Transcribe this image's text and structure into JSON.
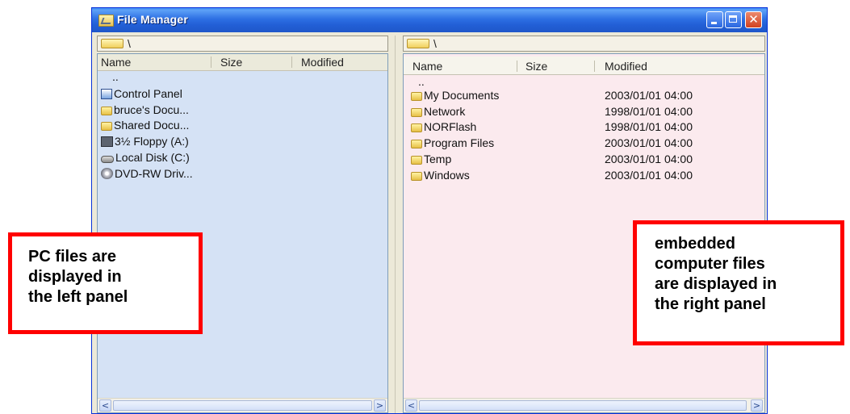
{
  "window": {
    "title": "File Manager",
    "controls": [
      "minimize-icon",
      "maximize-icon",
      "close-icon"
    ]
  },
  "left_pane": {
    "path": "\\",
    "columns": [
      "Name",
      "Size",
      "Modified"
    ],
    "items": [
      {
        "name": "..",
        "icon": "parent-dir",
        "size": "",
        "modified": ""
      },
      {
        "name": "Control Panel",
        "icon": "control-panel-icon",
        "size": "",
        "modified": ""
      },
      {
        "name": "bruce's Docu...",
        "icon": "folder-icon",
        "size": "",
        "modified": ""
      },
      {
        "name": "Shared Docu...",
        "icon": "folder-icon",
        "size": "",
        "modified": ""
      },
      {
        "name": "3½ Floppy (A:)",
        "icon": "floppy-drive-icon",
        "size": "",
        "modified": ""
      },
      {
        "name": "Local Disk (C:)",
        "icon": "hard-disk-icon",
        "size": "",
        "modified": ""
      },
      {
        "name": "DVD-RW Driv...",
        "icon": "dvd-drive-icon",
        "size": "",
        "modified": ""
      }
    ],
    "scrollbar": {
      "left_arrow": "<",
      "right_arrow": ">"
    }
  },
  "right_pane": {
    "path": "\\",
    "columns": [
      "Name",
      "Size",
      "Modified"
    ],
    "items": [
      {
        "name": "..",
        "icon": "parent-dir",
        "size": "",
        "modified": ""
      },
      {
        "name": "My Documents",
        "icon": "folder-icon",
        "size": "",
        "modified": "2003/01/01 04:00"
      },
      {
        "name": "Network",
        "icon": "folder-icon",
        "size": "",
        "modified": "1998/01/01 04:00"
      },
      {
        "name": "NORFlash",
        "icon": "folder-icon",
        "size": "",
        "modified": "1998/01/01 04:00"
      },
      {
        "name": "Program Files",
        "icon": "folder-icon",
        "size": "",
        "modified": "2003/01/01 04:00"
      },
      {
        "name": "Temp",
        "icon": "folder-icon",
        "size": "",
        "modified": "2003/01/01 04:00"
      },
      {
        "name": "Windows",
        "icon": "folder-icon",
        "size": "",
        "modified": "2003/01/01 04:00"
      }
    ],
    "scrollbar": {
      "left_arrow": "<",
      "right_arrow": ">"
    }
  },
  "annotations": {
    "left": [
      "PC files are",
      "displayed in",
      "the left panel"
    ],
    "right": [
      "embedded",
      "computer files",
      "are displayed in",
      "the right panel"
    ]
  },
  "colors": {
    "left_pane_bg": "#d5e2f5",
    "right_pane_bg": "#fbeaee",
    "callout_border": "#ff0000",
    "titlebar": "#225fd6"
  }
}
